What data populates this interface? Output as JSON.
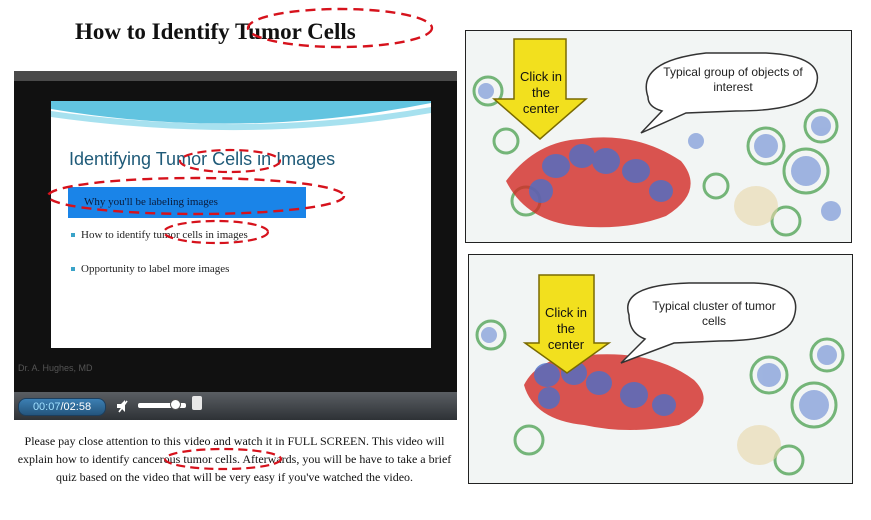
{
  "title": "How to Identify Tumor Cells",
  "video": {
    "slide": {
      "heading": "Identifying Tumor Cells in Images",
      "bullets": [
        "Why you'll be labeling images",
        "How to identify tumor cells in images",
        "Opportunity to label more images"
      ]
    },
    "caption": "Dr. A. Hughes, MD",
    "controls": {
      "current_time": "00:07",
      "separator": "/",
      "total_time": "02:58"
    }
  },
  "description": "Please pay close attention to this video and watch it in FULL SCREEN. This video will explain how to identify cancerous tumor cells. Afterwards, you will be have to take a brief quiz based on the video that will be very easy if you've watched the video.",
  "panels": [
    {
      "arrow_label": "Click in the center",
      "callout": "Typical group of objects of interest"
    },
    {
      "arrow_label": "Click in the center",
      "callout": "Typical cluster of tumor cells"
    }
  ],
  "colors": {
    "annotation_red": "#d6121c",
    "slide_highlight": "#1a84e8",
    "time_current": "#9fe0ff"
  }
}
